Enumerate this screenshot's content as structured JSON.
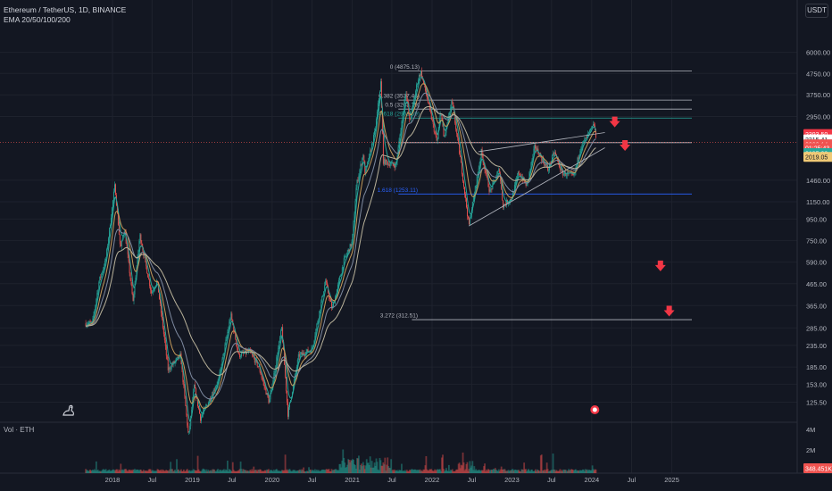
{
  "header": {
    "symbol": "Ethereum / TetherUS, 1D, BINANCE",
    "indicator": "EMA 20/50/100/200",
    "currency": "USDT"
  },
  "volume_pane": {
    "label": "Vol · ETH",
    "last_tag": "348.451K"
  },
  "colors": {
    "background": "#131722",
    "up": "#26a69a",
    "down": "#ef5350",
    "ema20": "#26a69a",
    "ema50": "#c49a5a",
    "ema100": "#7e8aa0",
    "ema200": "#b9b29a",
    "fib_main": "#b2b5be",
    "fib_618": "#26a69a",
    "fib_1618": "#2962ff",
    "arrow": "#f23645"
  },
  "chart_data": {
    "type": "candlestick",
    "y_scale": "log",
    "x_ticks": [
      "2018",
      "Jul",
      "2019",
      "Jul",
      "2020",
      "Jul",
      "2021",
      "Jul",
      "2022",
      "Jul",
      "2023",
      "Jul",
      "2024",
      "Jul",
      "2025"
    ],
    "y_ticks": [
      "6000.00",
      "4750.00",
      "3750.00",
      "2950.00",
      "1460.00",
      "1150.00",
      "950.00",
      "750.00",
      "590.00",
      "465.00",
      "365.00",
      "285.00",
      "235.00",
      "185.00",
      "153.00",
      "125.50"
    ],
    "vol_ticks": [
      "4M",
      "2M"
    ],
    "ylim": [
      105,
      8000
    ],
    "price_path": [
      [
        "2017-09-01",
        300
      ],
      [
        "2017-10-01",
        300
      ],
      [
        "2017-11-01",
        480
      ],
      [
        "2017-12-01",
        600
      ],
      [
        "2018-01-12",
        1390
      ],
      [
        "2018-02-06",
        680
      ],
      [
        "2018-02-25",
        860
      ],
      [
        "2018-04-05",
        380
      ],
      [
        "2018-05-06",
        800
      ],
      [
        "2018-06-28",
        420
      ],
      [
        "2018-07-24",
        480
      ],
      [
        "2018-09-12",
        180
      ],
      [
        "2018-11-08",
        210
      ],
      [
        "2018-12-15",
        85
      ],
      [
        "2019-01-10",
        150
      ],
      [
        "2019-02-07",
        105
      ],
      [
        "2019-05-01",
        160
      ],
      [
        "2019-06-26",
        330
      ],
      [
        "2019-08-01",
        210
      ],
      [
        "2019-09-20",
        220
      ],
      [
        "2019-11-01",
        185
      ],
      [
        "2019-12-18",
        125
      ],
      [
        "2020-02-14",
        285
      ],
      [
        "2020-03-13",
        110
      ],
      [
        "2020-05-01",
        210
      ],
      [
        "2020-07-01",
        225
      ],
      [
        "2020-09-01",
        480
      ],
      [
        "2020-10-01",
        350
      ],
      [
        "2020-11-24",
        600
      ],
      [
        "2021-01-01",
        740
      ],
      [
        "2021-01-20",
        1380
      ],
      [
        "2021-02-20",
        1950
      ],
      [
        "2021-03-01",
        1560
      ],
      [
        "2021-04-15",
        2500
      ],
      [
        "2021-05-11",
        4300
      ],
      [
        "2021-05-23",
        1800
      ],
      [
        "2021-06-22",
        1750
      ],
      [
        "2021-07-20",
        1720
      ],
      [
        "2021-09-03",
        3950
      ],
      [
        "2021-09-21",
        2750
      ],
      [
        "2021-10-25",
        4300
      ],
      [
        "2021-11-10",
        4875
      ],
      [
        "2021-12-04",
        3800
      ],
      [
        "2022-01-24",
        2200
      ],
      [
        "2022-02-10",
        3200
      ],
      [
        "2022-02-24",
        2300
      ],
      [
        "2022-04-02",
        3500
      ],
      [
        "2022-05-12",
        1800
      ],
      [
        "2022-06-18",
        880
      ],
      [
        "2022-08-14",
        2000
      ],
      [
        "2022-09-22",
        1280
      ],
      [
        "2022-11-05",
        1650
      ],
      [
        "2022-11-21",
        1100
      ],
      [
        "2022-12-31",
        1200
      ],
      [
        "2023-01-31",
        1600
      ],
      [
        "2023-03-10",
        1370
      ],
      [
        "2023-04-16",
        2130
      ],
      [
        "2023-06-15",
        1630
      ],
      [
        "2023-07-14",
        2000
      ],
      [
        "2023-08-17",
        1580
      ],
      [
        "2023-10-12",
        1530
      ],
      [
        "2023-11-10",
        2100
      ],
      [
        "2023-12-10",
        2350
      ],
      [
        "2024-01-12",
        2700
      ],
      [
        "2024-01-23",
        2220
      ]
    ],
    "fib_levels": [
      {
        "ratio": "0",
        "price": 4875.13,
        "label": "0 (4875.13)"
      },
      {
        "ratio": "0.382",
        "price": 3537.46,
        "label": "0.382 (3537.46)"
      },
      {
        "ratio": "0.5",
        "price": 3203.79,
        "label": "0.5 (3203.79)"
      },
      {
        "ratio": "0.618",
        "price": 2901.59,
        "label": "0.618 (2901.59)"
      },
      {
        "ratio": "1",
        "price": 2210.0,
        "label": ""
      },
      {
        "ratio": "1.618",
        "price": 1253.11,
        "label": "1.618 (1253.11)"
      },
      {
        "ratio": "3.272",
        "price": 312.51,
        "label": "3.272 (312.51)"
      }
    ],
    "price_tags": [
      {
        "label": "2393.50",
        "price": 2420,
        "bg": "#f23645",
        "fg": "#ffffff"
      },
      {
        "label": "2315.41",
        "price": 2280,
        "bg": "#ffffff",
        "fg": "#131722"
      },
      {
        "label": "2220.14",
        "price": 2160,
        "bg": "#ef5350",
        "fg": "#ffffff"
      },
      {
        "label": "01:25:43",
        "price": 2075,
        "bg": "#ef5350",
        "fg": "#ffffff"
      },
      {
        "label": "2195.32",
        "price": 1960,
        "bg": "#26a69a",
        "fg": "#ffffff"
      },
      {
        "label": "2019.05",
        "price": 1880,
        "bg": "#f0c975",
        "fg": "#131722"
      }
    ],
    "last_price_line": 2220
  }
}
